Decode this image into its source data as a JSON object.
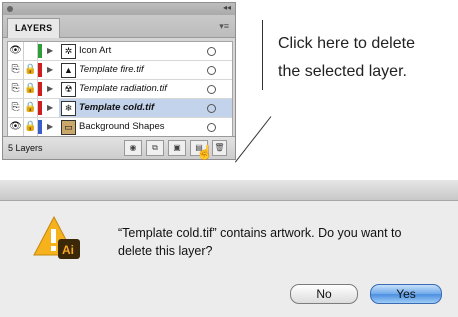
{
  "panel": {
    "tab": "LAYERS",
    "footer_count": "5 Layers",
    "layers": [
      {
        "name": "Icon Art",
        "style": "normal",
        "color": "#2e9d3a",
        "thumb": "✲",
        "vis": "👁",
        "lock": ""
      },
      {
        "name": "Template fire.tif",
        "style": "italic",
        "color": "#d01d1d",
        "thumb": "▲",
        "vis": "⎘",
        "lock": "🔒"
      },
      {
        "name": "Template radiation.tif",
        "style": "italic",
        "color": "#d01d1d",
        "thumb": "☢",
        "vis": "⎘",
        "lock": "🔒"
      },
      {
        "name": "Template cold.tif",
        "style": "bold-italic",
        "color": "#d01d1d",
        "thumb": "❄",
        "vis": "⎘",
        "lock": "🔒"
      },
      {
        "name": "Background Shapes",
        "style": "normal",
        "color": "#3a5ec9",
        "thumb": "▭",
        "vis": "👁",
        "lock": "🔒"
      }
    ]
  },
  "callout": {
    "line1": "Click here to delete",
    "line2": "the selected layer."
  },
  "dialog": {
    "message": "“Template cold.tif” contains artwork. Do you want to delete this layer?",
    "icon_label": "Ai",
    "no_label": "No",
    "yes_label": "Yes"
  }
}
